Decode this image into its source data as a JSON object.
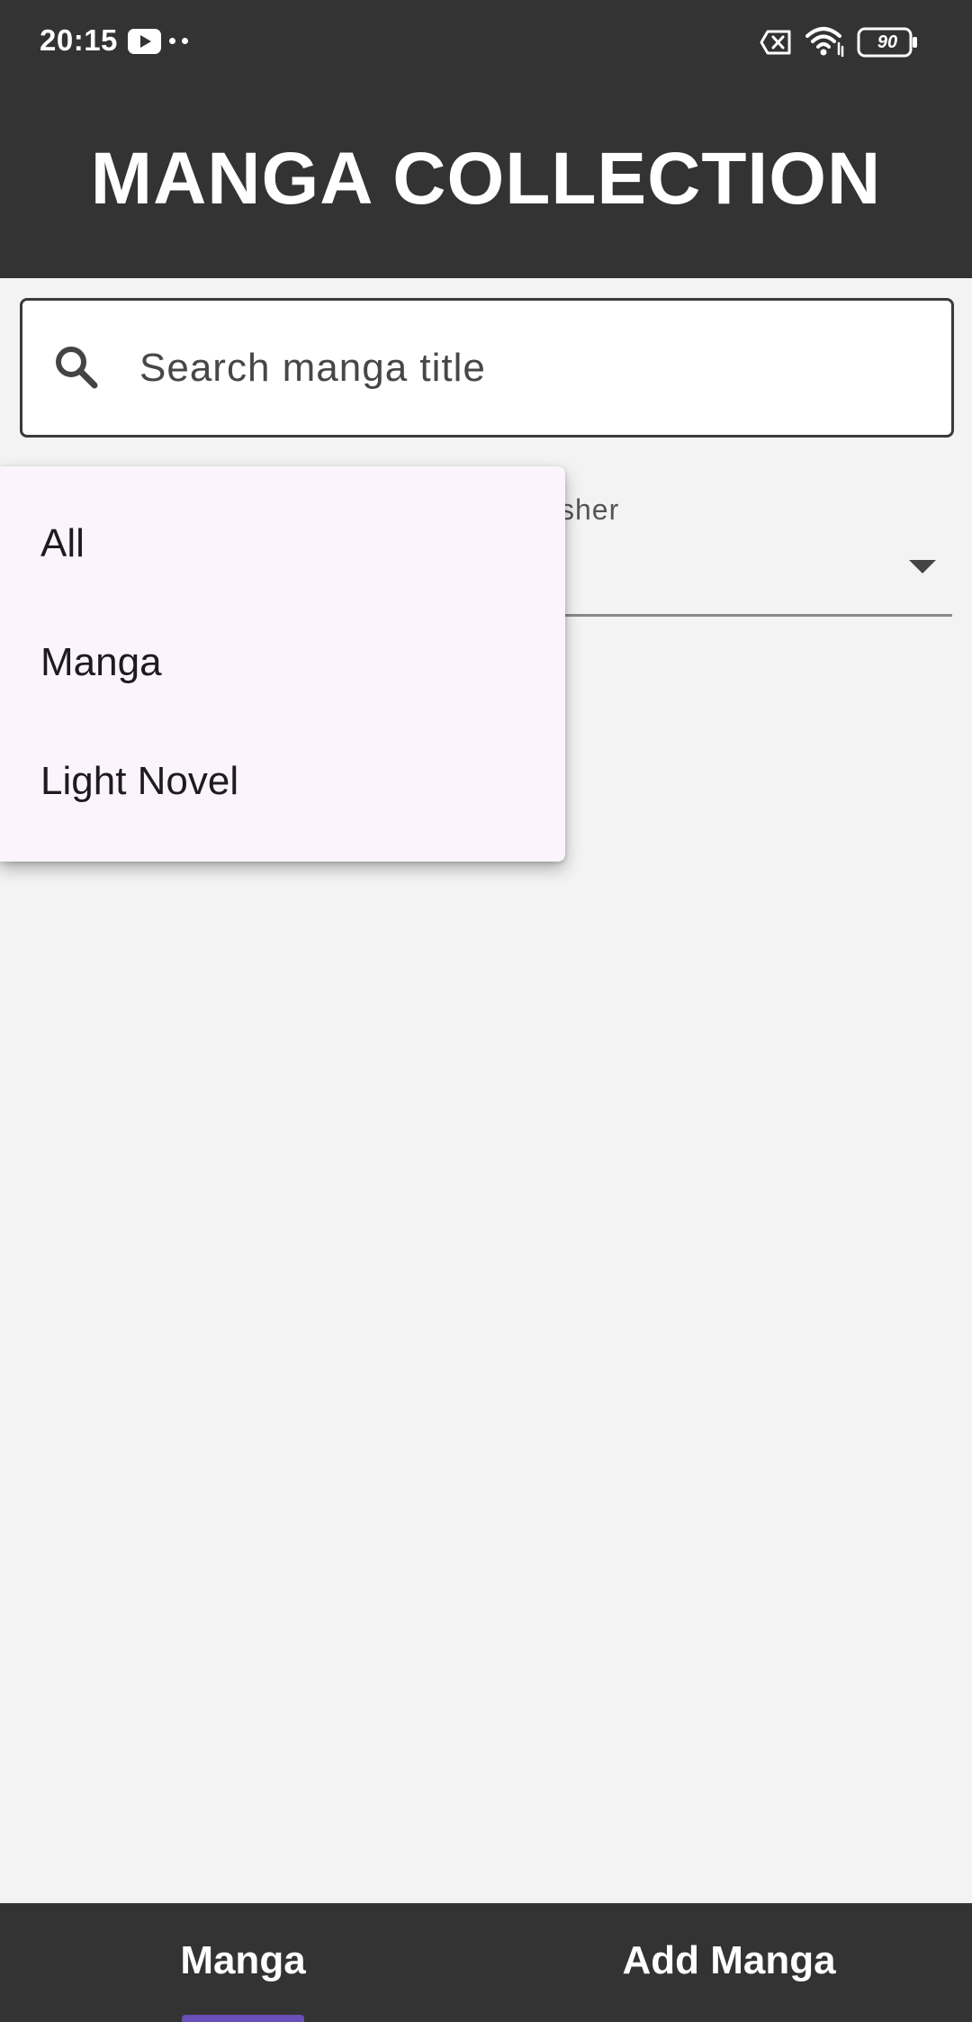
{
  "status_bar": {
    "time": "20:15",
    "battery_level": "90",
    "icons": [
      "youtube-icon",
      "more-dots-icon",
      "sim-off-icon",
      "wifi-icon",
      "battery-icon"
    ]
  },
  "header": {
    "title": "MANGA COLLECTION"
  },
  "search": {
    "placeholder": "Search manga title",
    "value": "",
    "icon": "search-icon"
  },
  "publisher_filter": {
    "label": "sher",
    "selected_value": "",
    "icon": "dropdown-arrow-icon"
  },
  "type_dropdown": {
    "options": [
      "All",
      "Manga",
      "Light Novel"
    ]
  },
  "bottom_nav": {
    "tabs": [
      {
        "label": "Manga",
        "active": true
      },
      {
        "label": "Add Manga",
        "active": false
      }
    ],
    "active_color": "#6a4fb6"
  },
  "colors": {
    "header_bg": "#333333",
    "page_bg": "#f3f3f3",
    "menu_bg": "#fcf4fc"
  }
}
